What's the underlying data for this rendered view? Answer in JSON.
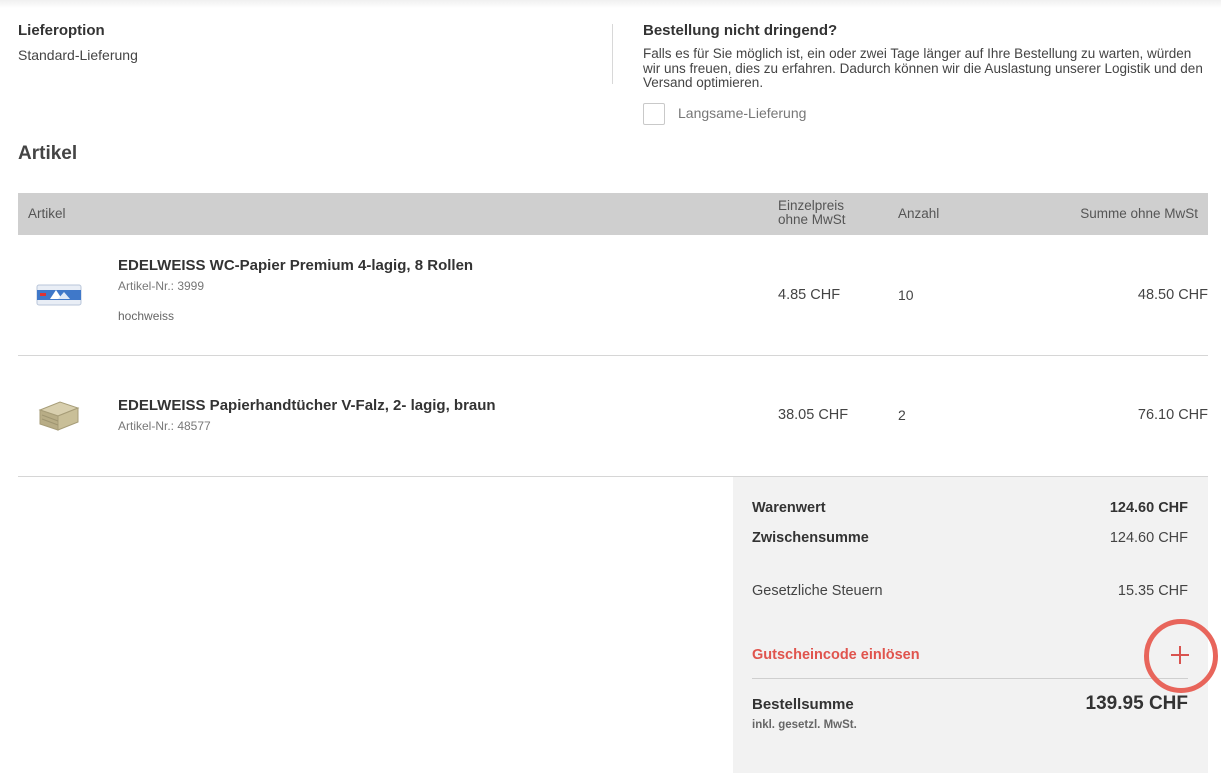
{
  "delivery": {
    "title": "Lieferoption",
    "value": "Standard-Lieferung"
  },
  "slow_delivery": {
    "title": "Bestellung nicht dringend?",
    "text": "Falls es für Sie möglich ist, ein oder zwei Tage länger auf Ihre Bestellung zu warten, würden wir uns freuen, dies zu erfahren. Dadurch können wir die Auslastung unserer Logistik und den Versand optimieren.",
    "checkbox_label": "Langsame-Lieferung",
    "checked": false
  },
  "articles": {
    "section_title": "Artikel",
    "columns": {
      "article": "Artikel",
      "unit_price_line1": "Einzelpreis",
      "unit_price_line2": "ohne MwSt",
      "quantity": "Anzahl",
      "sum": "Summe ohne MwSt"
    },
    "items": [
      {
        "name": "EDELWEISS WC-Papier Premium 4-lagig, 8 Rollen",
        "article_no": "Artikel-Nr.: 3999",
        "variant": "hochweiss",
        "unit_price": "4.85 CHF",
        "quantity": "10",
        "sum": "48.50 CHF",
        "thumb_icon": "toilet-paper-pack-icon"
      },
      {
        "name": "EDELWEISS Papierhandtücher V-Falz, 2- lagig, braun",
        "article_no": "Artikel-Nr.: 48577",
        "variant": "",
        "unit_price": "38.05 CHF",
        "quantity": "2",
        "sum": "76.10 CHF",
        "thumb_icon": "paper-towel-stack-icon"
      }
    ]
  },
  "summary": {
    "goods_value_label": "Warenwert",
    "goods_value": "124.60 CHF",
    "subtotal_label": "Zwischensumme",
    "subtotal": "124.60 CHF",
    "taxes_label": "Gesetzliche Steuern",
    "taxes": "15.35 CHF",
    "voucher_label": "Gutscheincode einlösen",
    "voucher_icon": "plus-icon",
    "total_label": "Bestellsumme",
    "total_note": "inkl. gesetzl. MwSt.",
    "total": "139.95 CHF"
  },
  "colors": {
    "header_bg": "#cfcfcf",
    "summary_bg": "#f2f2f2",
    "accent_red": "#e0544d",
    "highlight_ring": "#e8655b"
  }
}
